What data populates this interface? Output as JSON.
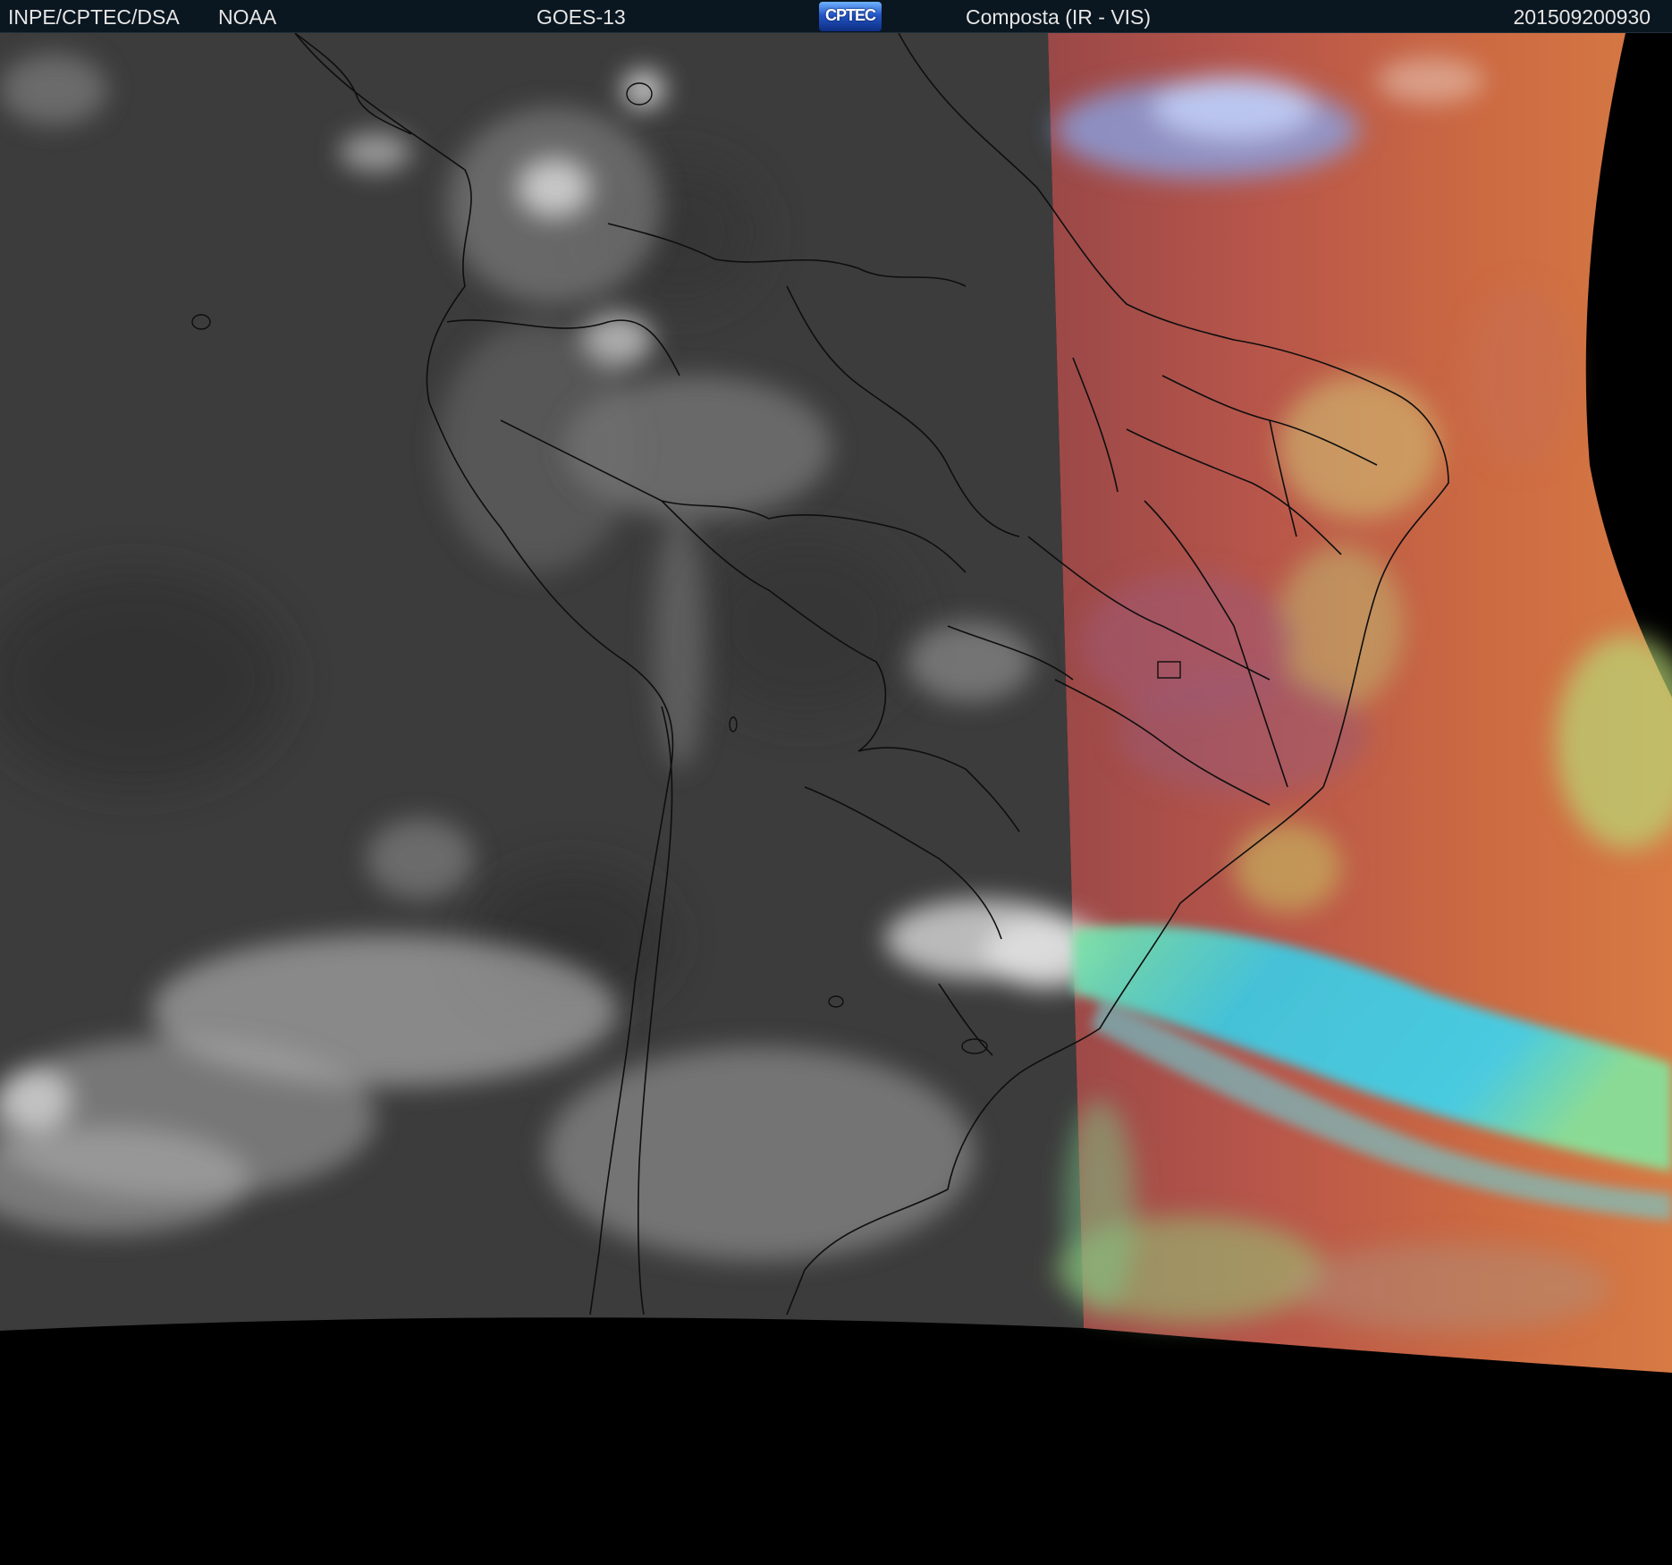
{
  "header": {
    "source": "INPE/CPTEC/DSA",
    "agency": "NOAA",
    "satellite": "GOES-13",
    "logo_text": "CPTEC",
    "product": "Composta (IR - VIS)",
    "timestamp": "201509200930"
  },
  "colors": {
    "header_bg": "#0a1620",
    "ir_gray": "#3a3a3a",
    "vis_red": "#c25040",
    "vis_orange": "#d8703c",
    "vis_green": "#a8d470",
    "vis_cyan": "#40c8e0",
    "space": "#000000",
    "borders": "#101010"
  }
}
